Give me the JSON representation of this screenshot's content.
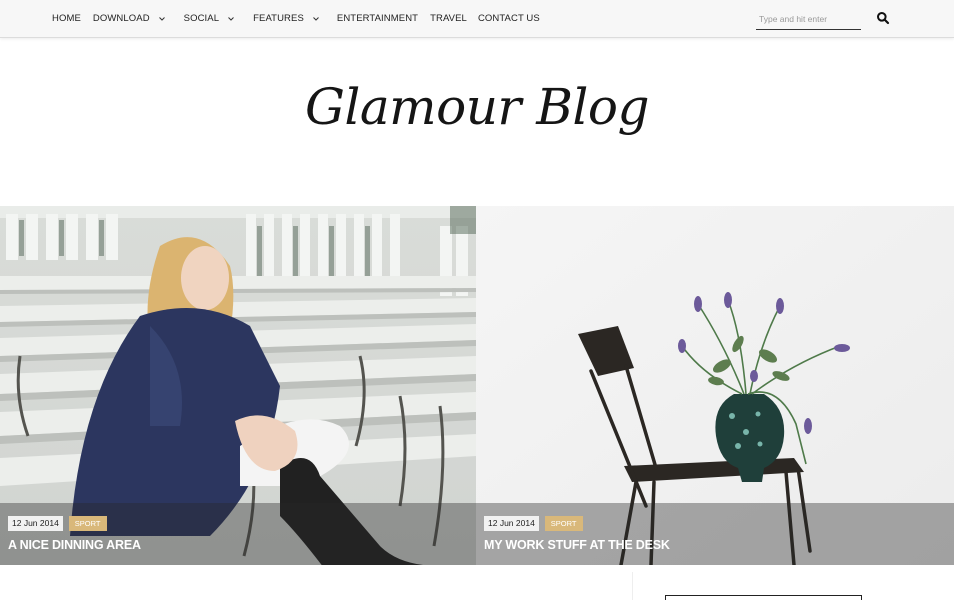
{
  "nav": {
    "items": [
      {
        "label": "HOME",
        "dropdown": false
      },
      {
        "label": "DOWNLOAD",
        "dropdown": true
      },
      {
        "label": "SOCIAL",
        "dropdown": true
      },
      {
        "label": "FEATURES",
        "dropdown": true
      },
      {
        "label": "ENTERTAINMENT",
        "dropdown": false
      },
      {
        "label": "TRAVEL",
        "dropdown": false
      },
      {
        "label": "CONTACT US",
        "dropdown": false
      }
    ],
    "search": {
      "placeholder": "Type and hit enter",
      "icon": "search-icon"
    }
  },
  "logo": {
    "text": "Glamour Blog"
  },
  "posts": [
    {
      "date": "12 Jun 2014",
      "category": "SPORT",
      "title": "A NICE DINNING AREA"
    },
    {
      "date": "12 Jun 2014",
      "category": "SPORT",
      "title": "MY WORK STUFF AT THE DESK"
    }
  ],
  "colors": {
    "accent": "#d9b87a",
    "nav_bg": "#f7f7f7",
    "text": "#222222"
  }
}
